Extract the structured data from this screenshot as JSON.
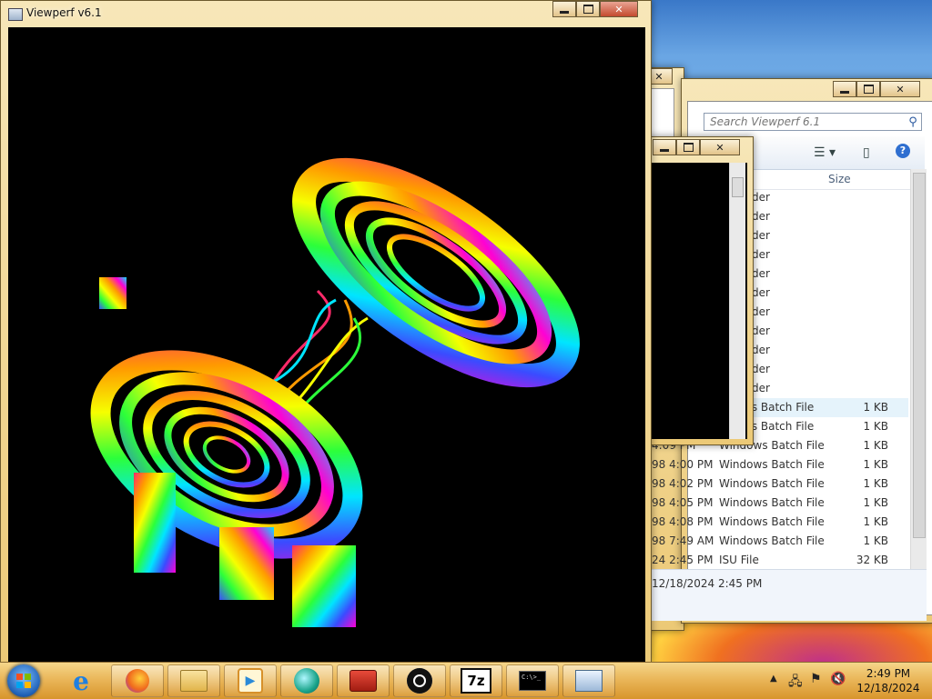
{
  "viewperf_window": {
    "title": "Viewperf v6.1"
  },
  "explorer_window": {
    "search_placeholder": "Search Viewperf 6.1",
    "column_size": "Size",
    "rows": [
      {
        "date": "",
        "type": "der",
        "size": ""
      },
      {
        "date": "",
        "type": "der",
        "size": ""
      },
      {
        "date": "",
        "type": "der",
        "size": ""
      },
      {
        "date": "",
        "type": "der",
        "size": ""
      },
      {
        "date": "",
        "type": "der",
        "size": ""
      },
      {
        "date": "",
        "type": "der",
        "size": ""
      },
      {
        "date": "",
        "type": "der",
        "size": ""
      },
      {
        "date": "",
        "type": "der",
        "size": ""
      },
      {
        "date": "",
        "type": "der",
        "size": ""
      },
      {
        "date": "",
        "type": "der",
        "size": ""
      },
      {
        "date": "",
        "type": "der",
        "size": ""
      },
      {
        "date": "",
        "type": "ws Batch File",
        "size": "1 KB"
      },
      {
        "date": "",
        "type": "ws Batch File",
        "size": "1 KB"
      },
      {
        "date": "4:09 PM",
        "type": "Windows Batch File",
        "size": "1 KB"
      },
      {
        "date": "98 4:00 PM",
        "type": "Windows Batch File",
        "size": "1 KB"
      },
      {
        "date": "98 4:02 PM",
        "type": "Windows Batch File",
        "size": "1 KB"
      },
      {
        "date": "98 4:05 PM",
        "type": "Windows Batch File",
        "size": "1 KB"
      },
      {
        "date": "98 4:08 PM",
        "type": "Windows Batch File",
        "size": "1 KB"
      },
      {
        "date": "98 7:49 AM",
        "type": "Windows Batch File",
        "size": "1 KB"
      },
      {
        "date": "24 2:45 PM",
        "type": "ISU File",
        "size": "32 KB"
      }
    ],
    "details_text": "12/18/2024 2:45 PM"
  },
  "taskbar": {
    "items": [
      {
        "name": "internet-explorer-icon"
      },
      {
        "name": "firefox-icon"
      },
      {
        "name": "file-explorer-icon"
      },
      {
        "name": "media-player-icon"
      },
      {
        "name": "media-center-icon"
      },
      {
        "name": "toolbox-icon"
      },
      {
        "name": "github-icon"
      },
      {
        "name": "7zip-icon"
      },
      {
        "name": "command-prompt-icon"
      },
      {
        "name": "window-app-icon"
      }
    ],
    "sevenzip_label": "7z",
    "cmd_label": "C:\\>_",
    "clock_time": "2:49 PM",
    "clock_date": "12/18/2024"
  },
  "colors": {
    "taskbar": "#eab75a",
    "frame": "#ecc976",
    "close_button": "#c44a2e",
    "selection": "#e5f3fb"
  }
}
